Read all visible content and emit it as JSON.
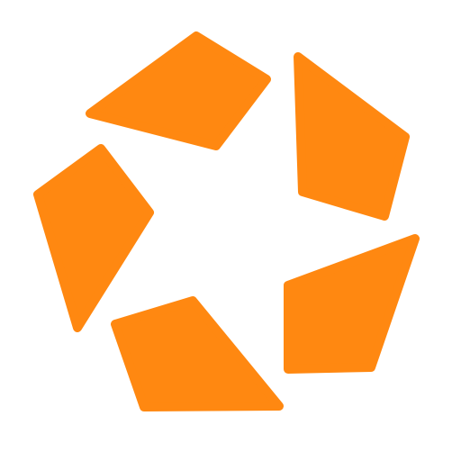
{
  "background": "#ffffff",
  "logo": {
    "icon": "pentagon-star-logo-icon",
    "color": "#ff8811",
    "segments": [
      "top-left",
      "top-right",
      "left",
      "bottom-left",
      "bottom-right"
    ]
  }
}
